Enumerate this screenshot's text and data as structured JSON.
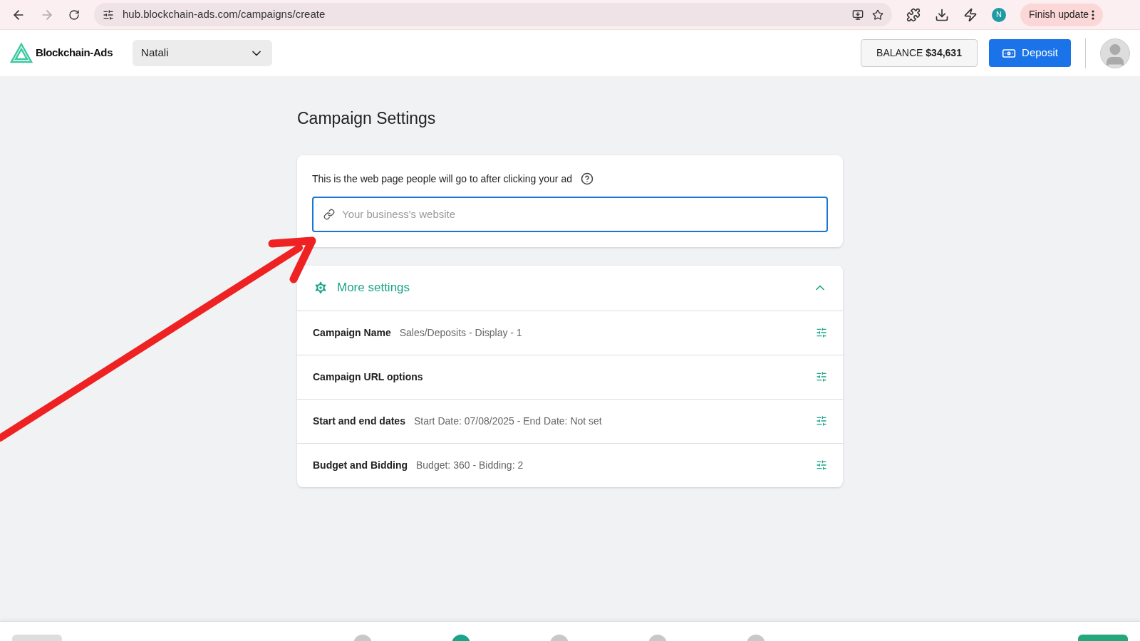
{
  "browser": {
    "url": "hub.blockchain-ads.com/campaigns/create",
    "profile_initial": "N",
    "update_label": "Finish update"
  },
  "header": {
    "logo": "Blockchain-Ads",
    "account": "Natali",
    "balance": "BALANCE **$34,631**",
    "deposit": "Deposit"
  },
  "page_title": "Campaign Settings",
  "url_card": {
    "label": "This is the web page people will go to after clicking your ad",
    "placeholder": "Your business's website"
  },
  "more_settings": {
    "title": "More settings",
    "expanded": true,
    "rows": [
      {
        "label": "Campaign Name",
        "value": "Sales/Deposits - Display - 1"
      },
      {
        "label": "Campaign URL options"
      },
      {
        "label": "Start and end dates",
        "value": "Start Date: 07/08/2025 - End Date: Not set"
      },
      {
        "label": "Budget and Bidding",
        "value": "Budget: 360 - Bidding: 2"
      }
    ]
  },
  "steps": [
    {
      "selected": false
    },
    {
      "selected": true
    },
    {
      "selected": false
    },
    {
      "selected": false
    },
    {
      "selected": false
    }
  ]
}
